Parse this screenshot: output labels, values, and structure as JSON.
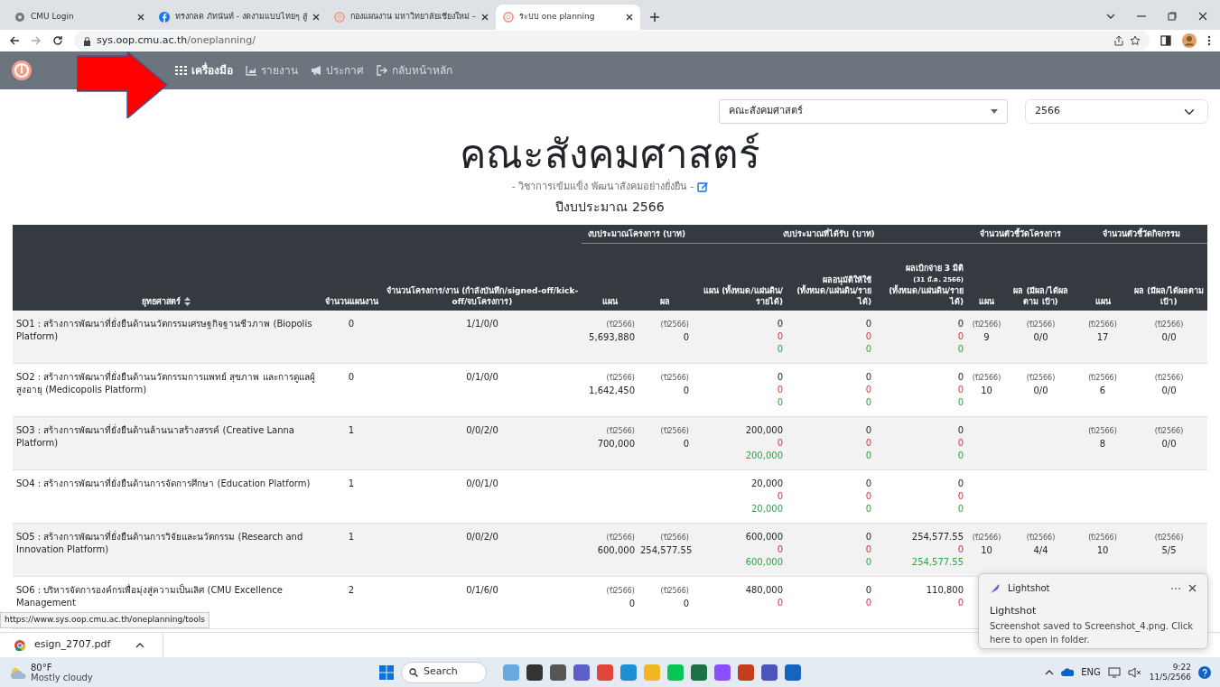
{
  "browser": {
    "tabs": [
      {
        "kind": "cmu",
        "title": "CMU Login",
        "selected": false
      },
      {
        "kind": "facebook",
        "title": "ทรงกลด ภัทนันท์ - งดงามแบบไทยๆ สู่",
        "selected": false
      },
      {
        "kind": "planning",
        "title": "กองแผนงาน มหาวิทยาลัยเชียงใหม่ –",
        "selected": false
      },
      {
        "kind": "planning",
        "title": "ระบบ one planning",
        "selected": true
      }
    ],
    "url_host": "sys.oop.cmu.ac.th",
    "url_path": "/oneplanning/"
  },
  "navbar": {
    "items": [
      {
        "kind": "grid",
        "label": "เครื่องมือ",
        "selected": true
      },
      {
        "kind": "chart",
        "label": "รายงาน",
        "selected": false
      },
      {
        "kind": "megaphone",
        "label": "ประกาศ",
        "selected": false
      },
      {
        "kind": "exit",
        "label": "กลับหน้าหลัก",
        "selected": false
      }
    ]
  },
  "filters": {
    "faculty": "คณะสังคมศาสตร์",
    "year": "2566"
  },
  "heading": {
    "title": "คณะสังคมศาสตร์",
    "motto": "- วิชาการเข้มแข็ง พัฒนาสังคมอย่างยั่งยืน -",
    "budget_year": "ปีงบประมาณ 2566"
  },
  "table": {
    "groups": [
      "งบประมาณโครงการ (บาท)",
      "งบประมาณที่ได้รับ (บาท)",
      "จำนวนตัวชี้วัดโครงการ",
      "จำนวนตัวชี้วัดกิจกรรม"
    ],
    "columns": [
      "ยุทธศาสตร์",
      "จำนวนแผนงาน",
      "จำนวนโครงการ/งาน (กำลังบันทึก/signed-off/kick-off/จบโครงการ)",
      "แผน",
      "ผล",
      "แผน (ทั้งหมด/แผ่นดิน/รายได้)",
      "ผลอนุมัติให้ใช้ (ทั้งหมด/แผ่นดิน/รายได้)",
      "ผลเบิกจ่าย 3 มิติ",
      "แผน",
      "ผล (มีผล/ได้ผลตาม เป้า)",
      "แผน",
      "ผล (มีผล/ได้ผลตาม เป้า)"
    ],
    "disbursed_date": "(31 มี.ค. 2566)",
    "disbursed_sub": "(ทั้งหมด/แผ่นดิน/รายได้)",
    "rows": [
      {
        "strategy": "SO1 : สร้างการพัฒนาที่ยั่งยืนด้านนวัตกรรมเศรษฐกิจฐานชีวภาพ (Biopolis Platform)",
        "plans": "0",
        "projects": "1/1/0/0",
        "budget_plan": {
          "year": "(ปี2566)",
          "value": "5,693,880"
        },
        "budget_result": {
          "year": "(ปี2566)",
          "value": "0"
        },
        "received": [
          "0",
          "0",
          "0"
        ],
        "approved": [
          "0",
          "0",
          "0"
        ],
        "disbursed": [
          "0",
          "0",
          "0"
        ],
        "project_kpi_plan": {
          "year": "(ปี2566)",
          "value": "9"
        },
        "project_kpi_result": {
          "year": "(ปี2566)",
          "value": "0/0"
        },
        "activity_kpi_plan": {
          "year": "(ปี2566)",
          "value": "17"
        },
        "activity_kpi_result": {
          "year": "(ปี2566)",
          "value": "0/0"
        }
      },
      {
        "strategy": "SO2 : สร้างการพัฒนาที่ยั่งยืนด้านนวัตกรรมการแพทย์ สุขภาพ และการดูแลผู้สูงอายุ (Medicopolis Platform)",
        "plans": "0",
        "projects": "0/1/0/0",
        "budget_plan": {
          "year": "(ปี2566)",
          "value": "1,642,450"
        },
        "budget_result": {
          "year": "(ปี2566)",
          "value": "0"
        },
        "received": [
          "0",
          "0",
          "0"
        ],
        "approved": [
          "0",
          "0",
          "0"
        ],
        "disbursed": [
          "0",
          "0",
          "0"
        ],
        "project_kpi_plan": {
          "year": "(ปี2566)",
          "value": "10"
        },
        "project_kpi_result": {
          "year": "(ปี2566)",
          "value": "0/0"
        },
        "activity_kpi_plan": {
          "year": "(ปี2566)",
          "value": "6"
        },
        "activity_kpi_result": {
          "year": "(ปี2566)",
          "value": "0/0"
        }
      },
      {
        "strategy": "SO3 : สร้างการพัฒนาที่ยั่งยืนด้านล้านนาสร้างสรรค์ (Creative Lanna Platform)",
        "plans": "1",
        "projects": "0/0/2/0",
        "budget_plan": {
          "year": "(ปี2566)",
          "value": "700,000"
        },
        "budget_result": {
          "year": "(ปี2566)",
          "value": "0"
        },
        "received": [
          "200,000",
          "0",
          "200,000"
        ],
        "approved": [
          "0",
          "0",
          "0"
        ],
        "disbursed": [
          "0",
          "0",
          "0"
        ],
        "activity_kpi_plan": {
          "year": "(ปี2566)",
          "value": "8"
        },
        "activity_kpi_result": {
          "year": "(ปี2566)",
          "value": "0/0"
        }
      },
      {
        "strategy": "SO4 : สร้างการพัฒนาที่ยั่งยืนด้านการจัดการศึกษา (Education Platform)",
        "plans": "1",
        "projects": "0/0/1/0",
        "received": [
          "20,000",
          "0",
          "20,000"
        ],
        "approved": [
          "0",
          "0",
          "0"
        ],
        "disbursed": [
          "0",
          "0",
          "0"
        ]
      },
      {
        "strategy": "SO5 : สร้างการพัฒนาที่ยั่งยืนด้านการวิจัยและนวัตกรรม (Research and Innovation Platform)",
        "plans": "1",
        "projects": "0/0/2/0",
        "budget_plan": {
          "year": "(ปี2566)",
          "value": "600,000"
        },
        "budget_result": {
          "year": "(ปี2566)",
          "value": "254,577.55"
        },
        "received": [
          "600,000",
          "0",
          "600,000"
        ],
        "approved": [
          "0",
          "0",
          "0"
        ],
        "disbursed": [
          "254,577.55",
          "0",
          "254,577.55"
        ],
        "project_kpi_plan": {
          "year": "(ปี2566)",
          "value": "10"
        },
        "project_kpi_result": {
          "year": "(ปี2566)",
          "value": "4/4"
        },
        "activity_kpi_plan": {
          "year": "(ปี2566)",
          "value": "10"
        },
        "activity_kpi_result": {
          "year": "(ปี2566)",
          "value": "5/5"
        }
      },
      {
        "strategy": "SO6 : บริหารจัดการองค์กรเพื่อมุ่งสู่ความเป็นเลิศ (CMU Excellence Management",
        "plans": "2",
        "projects": "0/1/6/0",
        "budget_plan": {
          "year": "(ปี2566)",
          "value": "0"
        },
        "budget_result": {
          "year": "(ปี2566)",
          "value": "0"
        },
        "received": [
          "480,000",
          "0"
        ],
        "approved": [
          "0",
          "0"
        ],
        "disbursed": [
          "110,800",
          "0"
        ]
      }
    ]
  },
  "status_url": "https://www.sys.oop.cmu.ac.th/oneplanning/tools",
  "download": {
    "file": "esign_2707.pdf"
  },
  "toast": {
    "app": "Lightshot",
    "title": "Lightshot",
    "message": "Screenshot saved to Screenshot_4.png. Click here to open in folder."
  },
  "taskbar": {
    "temperature": "80°F",
    "weather": "Mostly cloudy",
    "search_placeholder": "Search",
    "language": "ENG",
    "time": "9:22",
    "date": "11/5/2566"
  }
}
